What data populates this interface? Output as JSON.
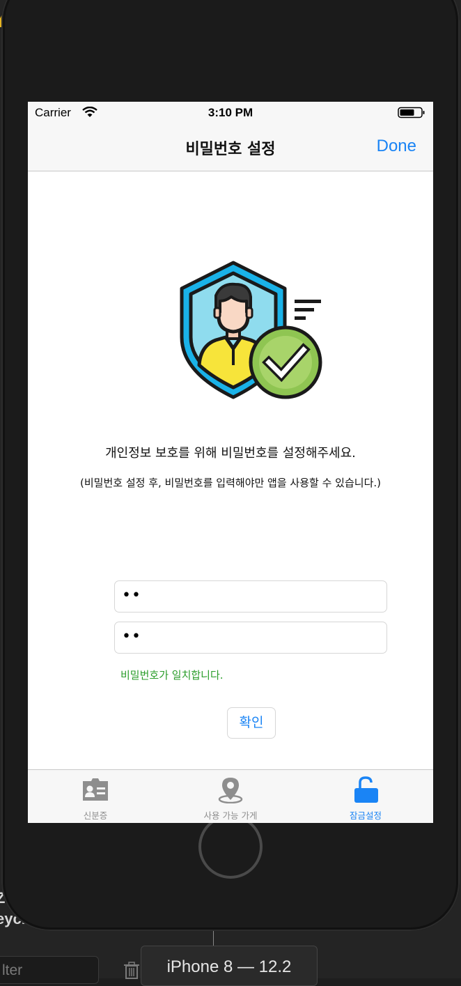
{
  "status_bar": {
    "carrier": "Carrier",
    "time": "3:10 PM"
  },
  "nav": {
    "title": "비밀번호 설정",
    "done_label": "Done"
  },
  "content": {
    "headline": "개인정보 보호를 위해 비밀번호를 설정해주세요.",
    "subline": "(비밀번호 설정 후, 비밀번호를 입력해야만 앱을 사용할 수 있습니다.)",
    "password_field_1": "••",
    "password_field_2": "••",
    "match_message": "비밀번호가 일치합니다.",
    "confirm_label": "확인"
  },
  "tabs": [
    {
      "label": "신분증",
      "icon": "id-card-icon",
      "active": false
    },
    {
      "label": "사용 가능 가게",
      "icon": "map-pin-icon",
      "active": false
    },
    {
      "label": "잠금설정",
      "icon": "unlock-icon",
      "active": true
    }
  ],
  "simulator": {
    "device_tab": "iPhone 8 — 12.2",
    "filter_placeholder": "lter",
    "partial_text_1": "Z",
    "partial_text_2": "eych"
  },
  "colors": {
    "accent": "#1a84f5",
    "success": "#2a9d2a",
    "shield_outer": "#1ab2e8",
    "check_badge": "#8fc552"
  }
}
